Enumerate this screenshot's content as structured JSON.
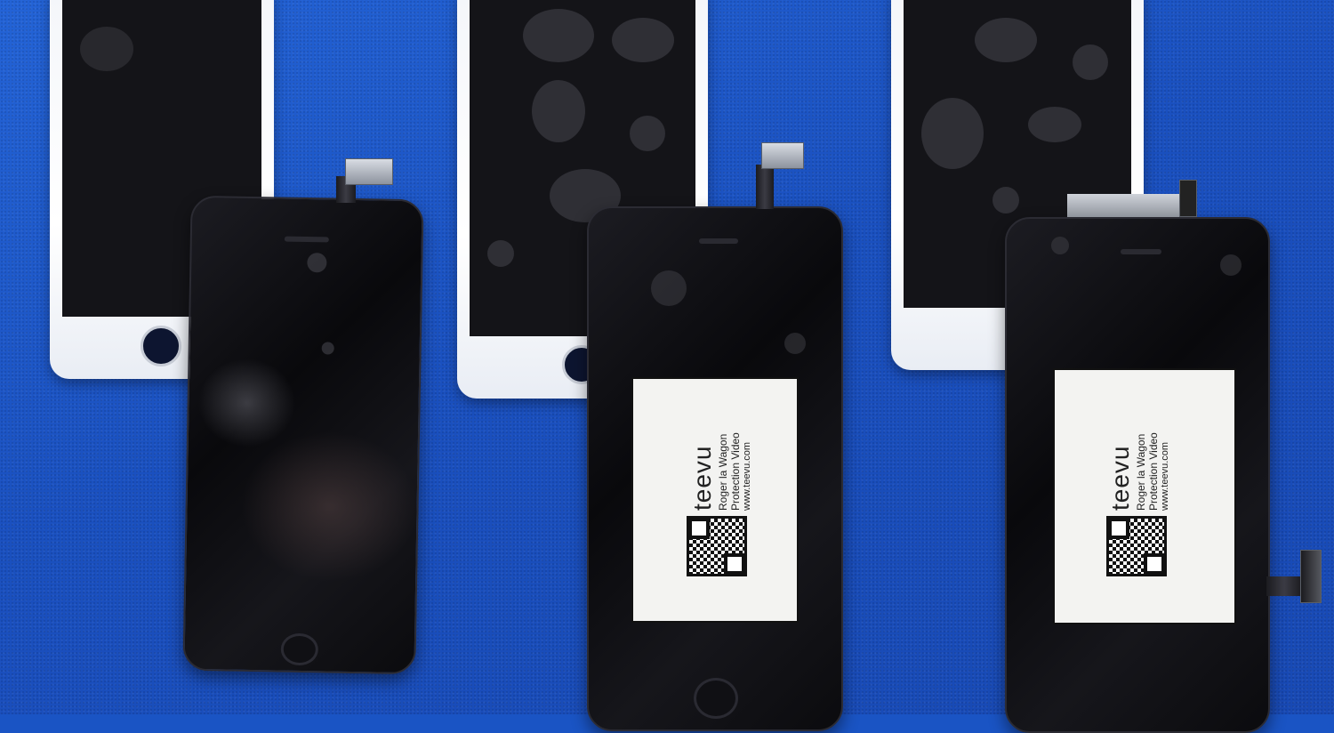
{
  "photo": {
    "subject": "iPhone replacement LCD screen assemblies on blue cloth",
    "colors": {
      "background_cloth": "#1b56c8",
      "white_frame": "#f4f6fa",
      "black_glass": "#0b0b0e"
    },
    "label_1": {
      "brand": "teevu",
      "line1": "Roger la Wagon",
      "line2": "Protection Video",
      "line3": "www.teevu.com"
    },
    "label_2": {
      "brand": "teevu",
      "line1": "Roger la Wagon",
      "line2": "Protection Video",
      "line3": "www.teevu.com"
    }
  }
}
